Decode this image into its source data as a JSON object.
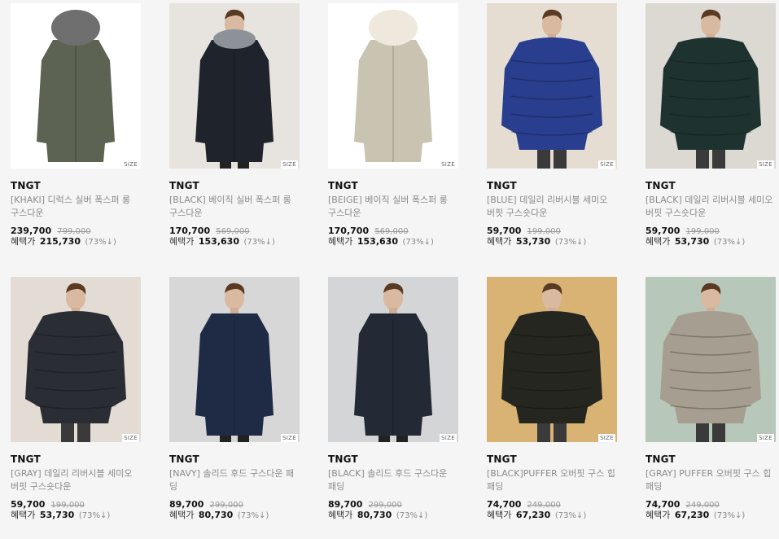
{
  "products": [
    {
      "brand": "TNGT",
      "name": "[KHAKI] 디럭스 실버 폭스퍼 롱 구스다운",
      "price": "239,700",
      "orig": "799,000",
      "benefit_label": "혜택가",
      "benefit_price": "215,730",
      "discount": "(73%↓)",
      "size_label": "SIZE",
      "bg": "#ffffff",
      "coat": "#5c6352",
      "model": false,
      "fur": "#6f6f6f",
      "type": "long"
    },
    {
      "brand": "TNGT",
      "name": "[BLACK] 베이직 실버 폭스퍼 롱 구스다운",
      "price": "170,700",
      "orig": "569,000",
      "benefit_label": "혜택가",
      "benefit_price": "153,630",
      "discount": "(73%↓)",
      "size_label": "SIZE",
      "bg": "#e7e4df",
      "coat": "#1f232c",
      "model": true,
      "fur": "#8d9299",
      "type": "long"
    },
    {
      "brand": "TNGT",
      "name": "[BEIGE] 베이직 실버 폭스퍼 롱 구스다운",
      "price": "170,700",
      "orig": "569,000",
      "benefit_label": "혜택가",
      "benefit_price": "153,630",
      "discount": "(73%↓)",
      "size_label": "SIZE",
      "bg": "#ffffff",
      "coat": "#c9c4b1",
      "model": false,
      "fur": "#efe9dd",
      "type": "long"
    },
    {
      "brand": "TNGT",
      "name": "[BLUE] 데일리 리버시블 세미오버핏 구스숏다운",
      "price": "59,700",
      "orig": "199,000",
      "benefit_label": "혜택가",
      "benefit_price": "53,730",
      "discount": "(73%↓)",
      "size_label": "SIZE",
      "bg": "#e6ddd2",
      "coat": "#2a3e8f",
      "model": true,
      "fur": "",
      "type": "short"
    },
    {
      "brand": "TNGT",
      "name": "[BLACK] 데일리 리버시블 세미오버핏 구스숏다운",
      "price": "59,700",
      "orig": "199,000",
      "benefit_label": "혜택가",
      "benefit_price": "53,730",
      "discount": "(73%↓)",
      "size_label": "SIZE",
      "bg": "#dcd8d2",
      "coat": "#1e3330",
      "model": true,
      "fur": "",
      "type": "short"
    },
    {
      "brand": "TNGT",
      "name": "[GRAY] 데일리 리버시블 세미오버핏 구스숏다운",
      "price": "59,700",
      "orig": "199,000",
      "benefit_label": "혜택가",
      "benefit_price": "53,730",
      "discount": "(73%↓)",
      "size_label": "SIZE",
      "bg": "#e3dcd4",
      "coat": "#2b2d35",
      "model": true,
      "fur": "",
      "type": "short"
    },
    {
      "brand": "TNGT",
      "name": "[NAVY] 솔리드 후드 구스다운 패딩",
      "price": "89,700",
      "orig": "299,000",
      "benefit_label": "혜택가",
      "benefit_price": "80,730",
      "discount": "(73%↓)",
      "size_label": "SIZE",
      "bg": "#d6d7d6",
      "coat": "#1f2b45",
      "model": true,
      "fur": "",
      "type": "long"
    },
    {
      "brand": "TNGT",
      "name": "[BLACK] 솔리드 후드 구스다운 패딩",
      "price": "89,700",
      "orig": "299,000",
      "benefit_label": "혜택가",
      "benefit_price": "80,730",
      "discount": "(73%↓)",
      "size_label": "SIZE",
      "bg": "#d4d5d6",
      "coat": "#232a36",
      "model": true,
      "fur": "",
      "type": "long"
    },
    {
      "brand": "TNGT",
      "name": "[BLACK]PUFFER 오버핏 구스 힙패딩",
      "price": "74,700",
      "orig": "249,000",
      "benefit_label": "혜택가",
      "benefit_price": "67,230",
      "discount": "(73%↓)",
      "size_label": "SIZE",
      "bg": "#d9b374",
      "coat": "#24261f",
      "model": true,
      "fur": "",
      "type": "short"
    },
    {
      "brand": "TNGT",
      "name": "[GRAY] PUFFER 오버핏 구스 힙패딩",
      "price": "74,700",
      "orig": "249,000",
      "benefit_label": "혜택가",
      "benefit_price": "67,230",
      "discount": "(73%↓)",
      "size_label": "SIZE",
      "bg": "#b7c7b9",
      "coat": "#a69e90",
      "model": true,
      "fur": "",
      "type": "short"
    }
  ]
}
